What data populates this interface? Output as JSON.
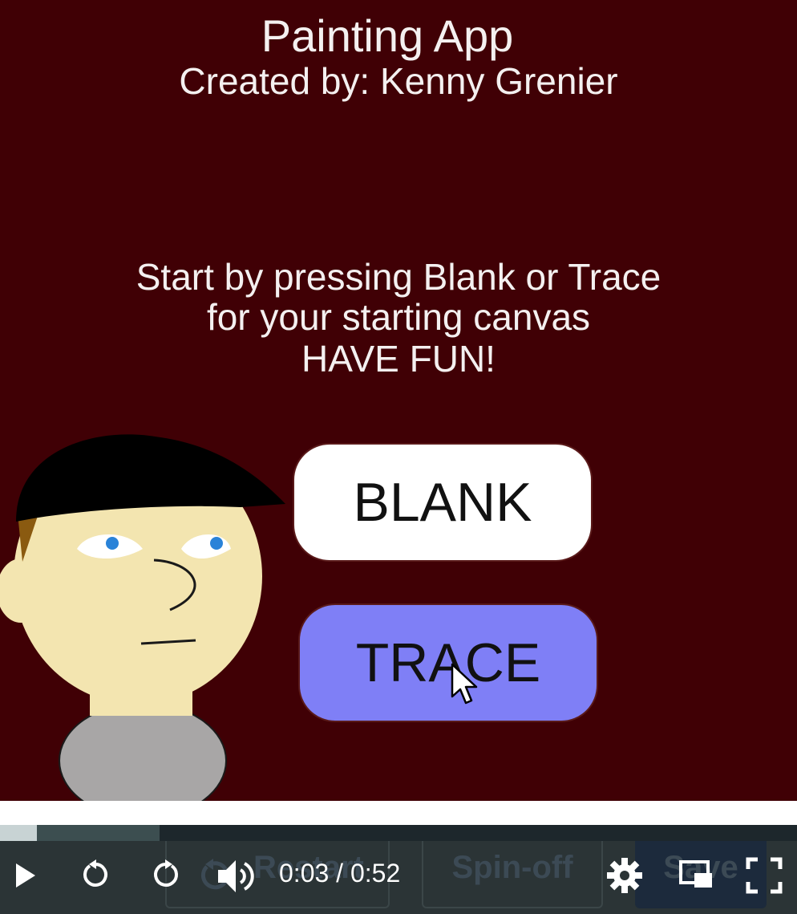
{
  "app": {
    "title": "Painting App",
    "subtitle": "Created by: Kenny Grenier",
    "instructions": [
      "Start by pressing Blank or Trace",
      "for your starting canvas",
      "HAVE FUN!"
    ],
    "buttons": {
      "blank": "BLANK",
      "trace": "TRACE"
    },
    "colors": {
      "background": "#400005",
      "blank_button": "#ffffff",
      "trace_button": "#7f7ff6"
    }
  },
  "player": {
    "time_display": "0:03 / 0:52",
    "progress_fraction": 0.046,
    "buffered_fraction": 0.2,
    "background_buttons": {
      "restart": "Restart",
      "spin_off": "Spin-off",
      "save": "Save"
    },
    "icons": [
      "play-icon",
      "replay-icon",
      "forward-icon",
      "volume-icon",
      "settings-icon",
      "picture-in-picture-icon",
      "fullscreen-icon"
    ]
  }
}
